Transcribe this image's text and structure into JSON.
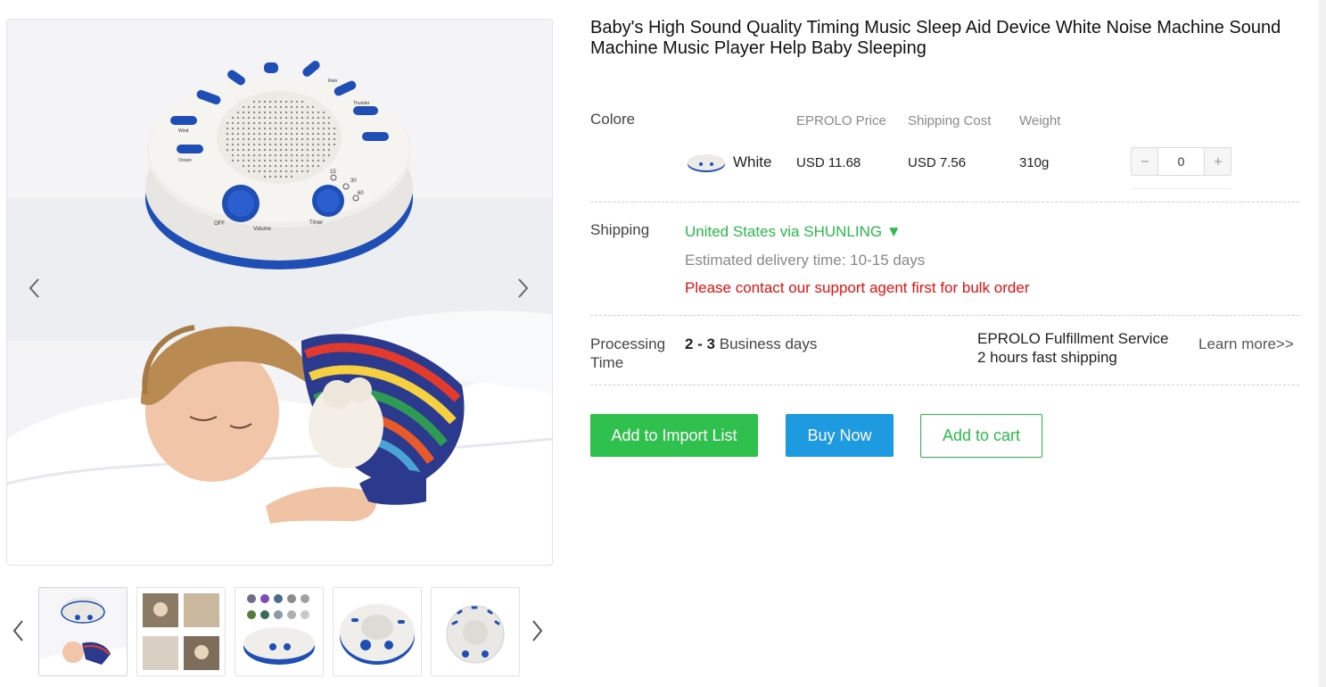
{
  "product": {
    "title": "Baby's High Sound Quality Timing Music Sleep Aid Device White Noise Machine Sound Machine Music Player Help Baby Sleeping"
  },
  "variants": {
    "label": "Colore",
    "headers": {
      "price": "EPROLO Price",
      "shipping": "Shipping Cost",
      "weight": "Weight"
    },
    "rows": [
      {
        "name": "White",
        "price": "USD 11.68",
        "shipping": "USD 7.56",
        "weight": "310g",
        "quantity": "0"
      }
    ]
  },
  "shipping": {
    "label": "Shipping",
    "method": "United States via SHUNLING",
    "dropdown_glyph": "▼",
    "estimate": "Estimated delivery time: 10-15 days",
    "notice": "Please contact our support agent first for bulk order"
  },
  "processing": {
    "label_line1": "Processing",
    "label_line2": "Time",
    "range": "2 - 3",
    "unit": "Business days",
    "service_line1": "EPROLO Fulfillment Service",
    "service_line2": "2 hours fast shipping",
    "learn_more": "Learn more>>"
  },
  "actions": {
    "import": "Add to Import List",
    "buy": "Buy Now",
    "cart": "Add to cart"
  },
  "gallery": {
    "thumb_count": 5,
    "active_index": 0
  },
  "device_labels": {
    "volume": "Volume",
    "timer": "Timer",
    "off": "OFF",
    "t15": "15",
    "t30": "30",
    "t60": "60",
    "sounds": [
      "Ocean",
      "Wind",
      "Brook",
      "Rain",
      "Bird",
      "Summer night",
      "Train",
      "Thunder",
      "Soothing music"
    ]
  },
  "colors": {
    "accent_green": "#2fc04d",
    "accent_blue": "#1e9be0",
    "alert_red": "#ee1111",
    "device_blue": "#1f4fb5"
  }
}
